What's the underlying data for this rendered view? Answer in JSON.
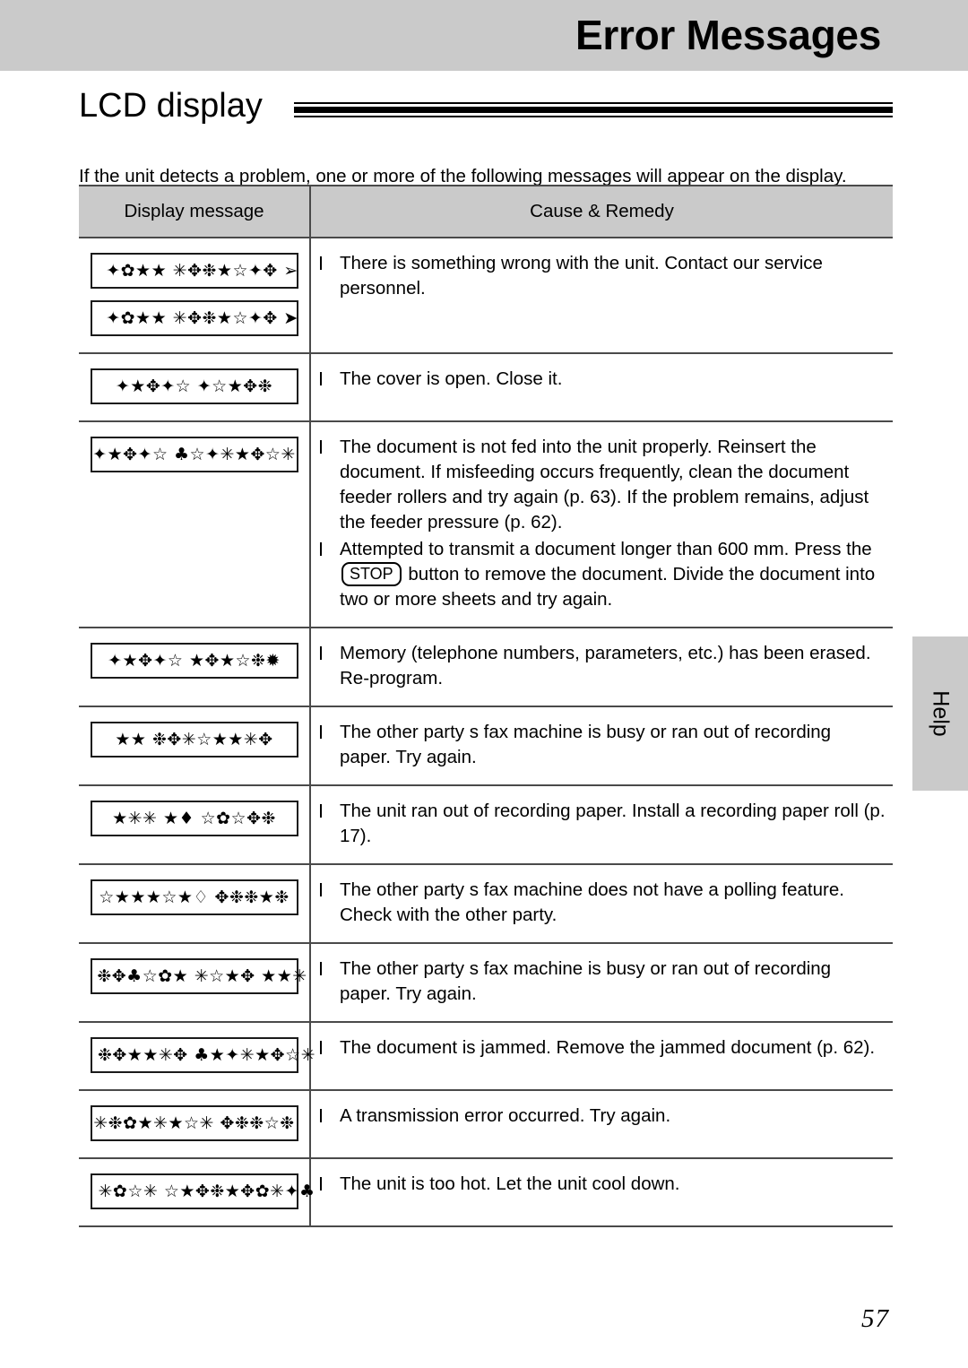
{
  "header": {
    "title": "Error Messages",
    "band_color": "#cacaca"
  },
  "section": {
    "title": "LCD display",
    "intro": "If the unit detects a problem, one or more of the following messages will appear on the display."
  },
  "table": {
    "columns": [
      "Display message",
      "Cause & Remedy"
    ],
    "rows": [
      {
        "messages": [
          "✦✿★★ ✳✥❉★☆✦✥ ➢",
          "✦✿★★ ✳✥❉★☆✦✥ ➤"
        ],
        "causes": [
          {
            "text": "There is something wrong with the unit. Contact our service personnel."
          }
        ]
      },
      {
        "messages": [
          "✦★✥✦☆ ✦☆★✥❉"
        ],
        "causes": [
          {
            "text": "The cover is open. Close it."
          }
        ]
      },
      {
        "messages": [
          "✦★✥✦☆ ♣☆✦✳★✥☆✳"
        ],
        "causes": [
          {
            "text": "The document is not fed into the unit properly. Reinsert the document. If misfeeding occurs frequently, clean the document feeder rollers and try again (p. 63). If the problem remains, adjust the feeder pressure (p. 62)."
          },
          {
            "pre": "Attempted to transmit a document longer than 600 mm. Press the",
            "key": "STOP",
            "post": "button to remove the document. Divide the document into two or more sheets and try again."
          }
        ]
      },
      {
        "messages": [
          "✦★✥✦☆ ★✥★☆❉✹"
        ],
        "causes": [
          {
            "text": "Memory (telephone numbers, parameters, etc.) has been erased. Re-program."
          }
        ]
      },
      {
        "messages": [
          "★★ ❉✥✳☆★★✳✥"
        ],
        "causes": [
          {
            "text": "The other party s fax machine is busy or ran out of recording paper. Try again."
          }
        ]
      },
      {
        "messages": [
          "★✳✳ ★♦ ☆✿☆✥❉"
        ],
        "causes": [
          {
            "text": "The unit ran out of recording paper. Install a recording paper roll (p. 17)."
          }
        ]
      },
      {
        "messages": [
          "☆★★★☆★♢ ✥❉❉★❉"
        ],
        "causes": [
          {
            "text": "The other party s fax machine does not have a polling feature. Check with the other party."
          }
        ]
      },
      {
        "messages": [
          "❉✥♣☆✿★ ✳☆★✥ ★★✳"
        ],
        "causes": [
          {
            "text": "The other party s fax machine is busy or ran out of recording paper. Try again."
          }
        ]
      },
      {
        "messages": [
          "❉✥★★✳✥ ♣★✦✳★✥☆✳"
        ],
        "causes": [
          {
            "text": "The document is jammed. Remove the jammed document (p. 62)."
          }
        ]
      },
      {
        "messages": [
          "✳❉✿★✳★☆✳ ✥❉❉☆❉"
        ],
        "causes": [
          {
            "text": "A transmission error occurred. Try again."
          }
        ]
      },
      {
        "messages": [
          "✳✿☆✳ ☆★✥❉★✥✿✳✦♣"
        ],
        "causes": [
          {
            "text": "The unit is too hot. Let the unit cool down."
          }
        ]
      }
    ]
  },
  "side_tab": {
    "label": "Help"
  },
  "footer": {
    "page_number": "57"
  }
}
